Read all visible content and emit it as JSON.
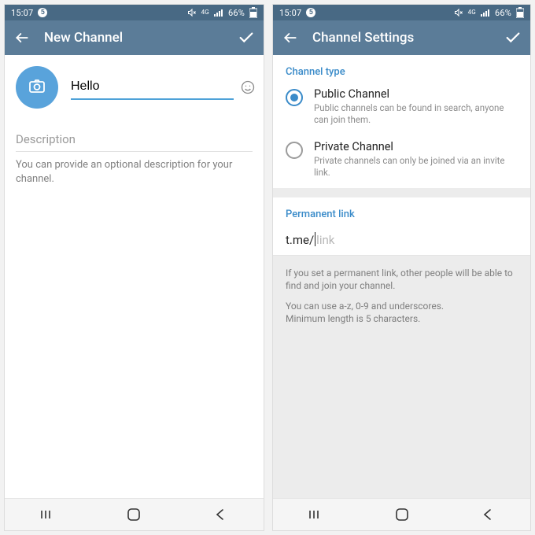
{
  "statusbar": {
    "time": "15:07",
    "notif_count": "5",
    "net_label": "4G",
    "battery_text": "66%"
  },
  "colors": {
    "telegram_header": "#5B7C98",
    "status_dark": "#486984",
    "accent": "#3a8bc9",
    "avatar_bg": "#59A3DB"
  },
  "left": {
    "appbar": {
      "title": "New Channel"
    },
    "name_input_value": "Hello",
    "desc_label": "Description",
    "desc_hint": "You can provide an optional description for your channel."
  },
  "right": {
    "appbar": {
      "title": "Channel Settings"
    },
    "section_type": "Channel type",
    "options": [
      {
        "label": "Public Channel",
        "hint": "Public channels can be found in search, anyone can join them.",
        "selected": true
      },
      {
        "label": "Private Channel",
        "hint": "Private channels can only be joined via an invite link.",
        "selected": false
      }
    ],
    "section_link": "Permanent link",
    "link_prefix": "t.me/",
    "link_placeholder": "link",
    "hint1": "If you set a permanent link, other people will be able to find and join your channel.",
    "hint2": "You can use a-z, 0-9 and underscores.",
    "hint3": "Minimum length is 5 characters."
  }
}
